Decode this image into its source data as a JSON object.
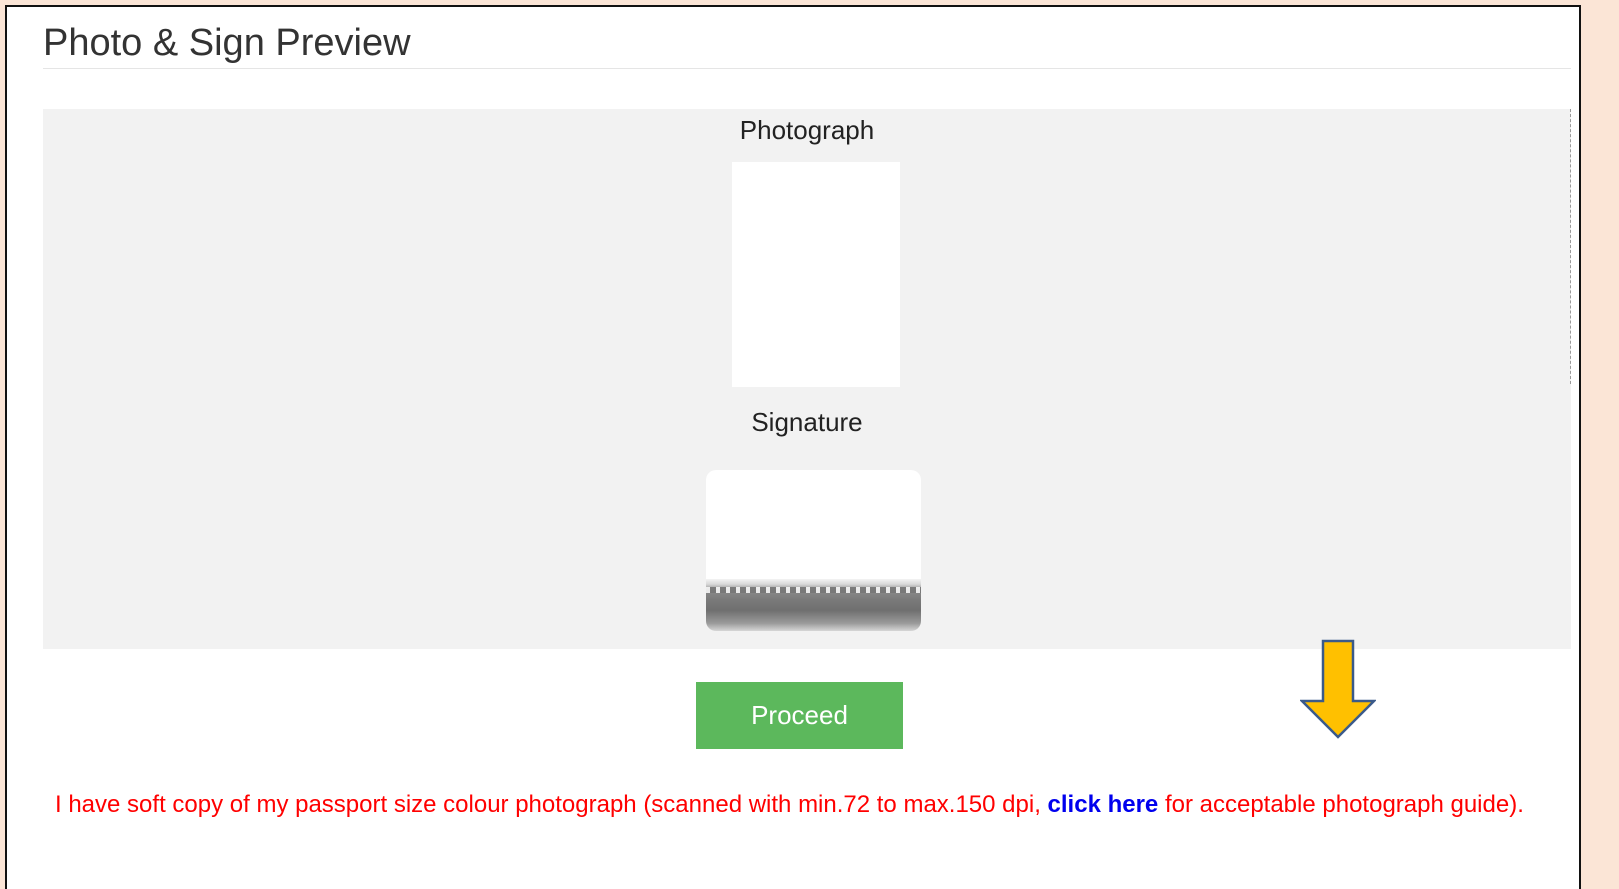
{
  "page": {
    "title": "Photo & Sign Preview"
  },
  "preview": {
    "photo_label": "Photograph",
    "signature_label": "Signature"
  },
  "actions": {
    "proceed_label": "Proceed"
  },
  "notice": {
    "text_before": "I have soft copy of my passport size colour photograph (scanned with min.72 to max.150 dpi, ",
    "link_text": "click here",
    "text_after": " for acceptable photograph guide)."
  },
  "colors": {
    "background": "#fbe5d6",
    "button": "#5cb85c",
    "notice_text": "#ff0000",
    "link": "#0000ee",
    "arrow": "#ffc000"
  },
  "icons": {
    "annotation_arrow": "down-arrow-icon"
  }
}
